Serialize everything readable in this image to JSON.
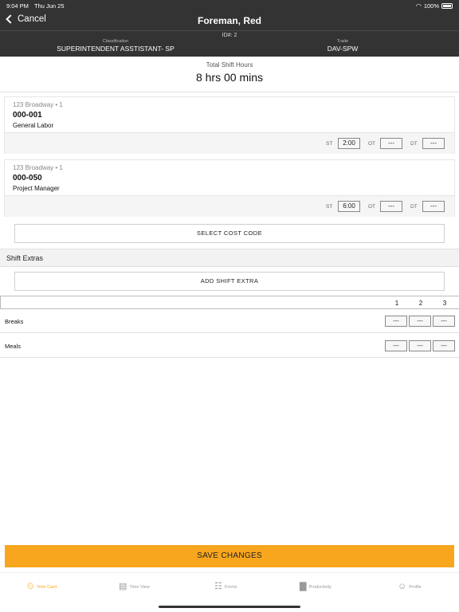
{
  "status_bar": {
    "time": "9:04 PM",
    "date": "Thu Jun 25",
    "battery": "100%"
  },
  "nav": {
    "back_label": "Cancel",
    "title": "Foreman, Red"
  },
  "employee": {
    "id_text": "ID#: 2",
    "classification_label": "Classification",
    "classification_value": "SUPERINTENDENT ASSTISTANT- SP",
    "trade_label": "Trade",
    "trade_value": "DAV-SPW"
  },
  "total": {
    "label": "Total Shift Hours",
    "value": "8 hrs 00 mins"
  },
  "cost_codes": [
    {
      "location": "123 Broadway • 1",
      "code": "000-001",
      "description": "General Labor",
      "st_label": "ST",
      "st_value": "2:00",
      "ot_label": "OT",
      "ot_value": "---",
      "dt_label": "DT",
      "dt_value": "---"
    },
    {
      "location": "123 Broadway • 1",
      "code": "000-050",
      "description": "Project Manager",
      "st_label": "ST",
      "st_value": "6:00",
      "ot_label": "OT",
      "ot_value": "---",
      "dt_label": "DT",
      "dt_value": "---"
    }
  ],
  "select_cost_code_label": "SELECT COST CODE",
  "shift_extras": {
    "title": "Shift Extras",
    "add_label": "ADD SHIFT EXTRA",
    "columns": [
      "1",
      "2",
      "3"
    ],
    "rows": [
      {
        "label": "Breaks",
        "values": [
          "---",
          "---",
          "---"
        ]
      },
      {
        "label": "Meals",
        "values": [
          "---",
          "---",
          "---"
        ]
      }
    ]
  },
  "save_label": "SAVE CHANGES",
  "tabs": [
    {
      "label": "Time Card",
      "icon": "timecard-icon",
      "active": true
    },
    {
      "label": "Time View",
      "icon": "calendar-icon",
      "active": false
    },
    {
      "label": "Forms",
      "icon": "clipboard-icon",
      "active": false
    },
    {
      "label": "Productivity",
      "icon": "bar-chart-icon",
      "active": false
    },
    {
      "label": "Profile",
      "icon": "person-icon",
      "active": false
    }
  ],
  "colors": {
    "header_bg": "#333333",
    "accent": "#f8a61d"
  }
}
